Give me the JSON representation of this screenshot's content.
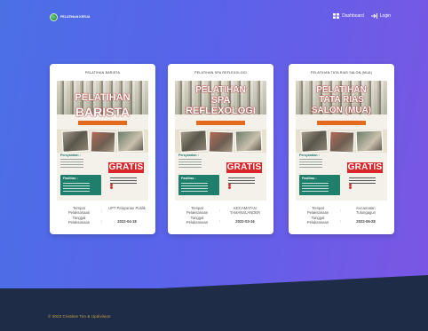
{
  "header": {
    "logo_text": "PELATIHAN KERJA",
    "nav": [
      {
        "label": "Dashboard",
        "icon": "dashboard-icon"
      },
      {
        "label": "Login",
        "icon": "login-icon"
      }
    ]
  },
  "cards": [
    {
      "title": "PELATIHAN BARISTA",
      "poster": {
        "line1": "PELATIHAN",
        "line2": "BARISTA",
        "line3": "",
        "gratis": "GRATIS",
        "persyaratan": "Persyaratan :",
        "fasilitas": "Fasilitas :"
      },
      "details": {
        "place_label": "Tempat Pelaksanaan",
        "place_value": "UPT Pelayanan Publik",
        "date_label": "Tanggal Pelaksanaan",
        "date_value": "2022-04-18"
      }
    },
    {
      "title": "PELATIHAN SPA REFLEXOLOGI",
      "poster": {
        "line1": "PELATIHAN",
        "line2": "SPA",
        "line3": "REFLEXOLOGI",
        "gratis": "GRATIS",
        "persyaratan": "Persyaratan :",
        "fasilitas": "Fasilitas :"
      },
      "details": {
        "place_label": "Tempat Pelaksanaan",
        "place_value": "KECAMATAN TAMANSLANDER",
        "date_label": "Tanggal Pelaksanaan",
        "date_value": "2022-03-16"
      }
    },
    {
      "title": "PELATIHAN TATA RIAS SALON (MUA)",
      "poster": {
        "line1": "PELATIHAN",
        "line2": "TATA RIAS",
        "line3": "SALON (MUA)",
        "gratis": "GRATIS",
        "persyaratan": "Persyaratan :",
        "fasilitas": "Fasilitas :"
      },
      "details": {
        "place_label": "Tempat Pelaksanaan",
        "place_value": "Kecamatan Tulungagun",
        "date_label": "Tanggal Pelaksanaan",
        "date_value": "2022-06-28"
      }
    }
  ],
  "footer": {
    "copyright": "© 2022 Creative Tim & Updivision"
  },
  "colors": {
    "hero_left": "#4b6fe6",
    "hero_right": "#7a56e4",
    "footer_bg": "#1e2c47",
    "gratis_red": "#d9262b",
    "fasilitas_green": "#1f7f6a"
  }
}
